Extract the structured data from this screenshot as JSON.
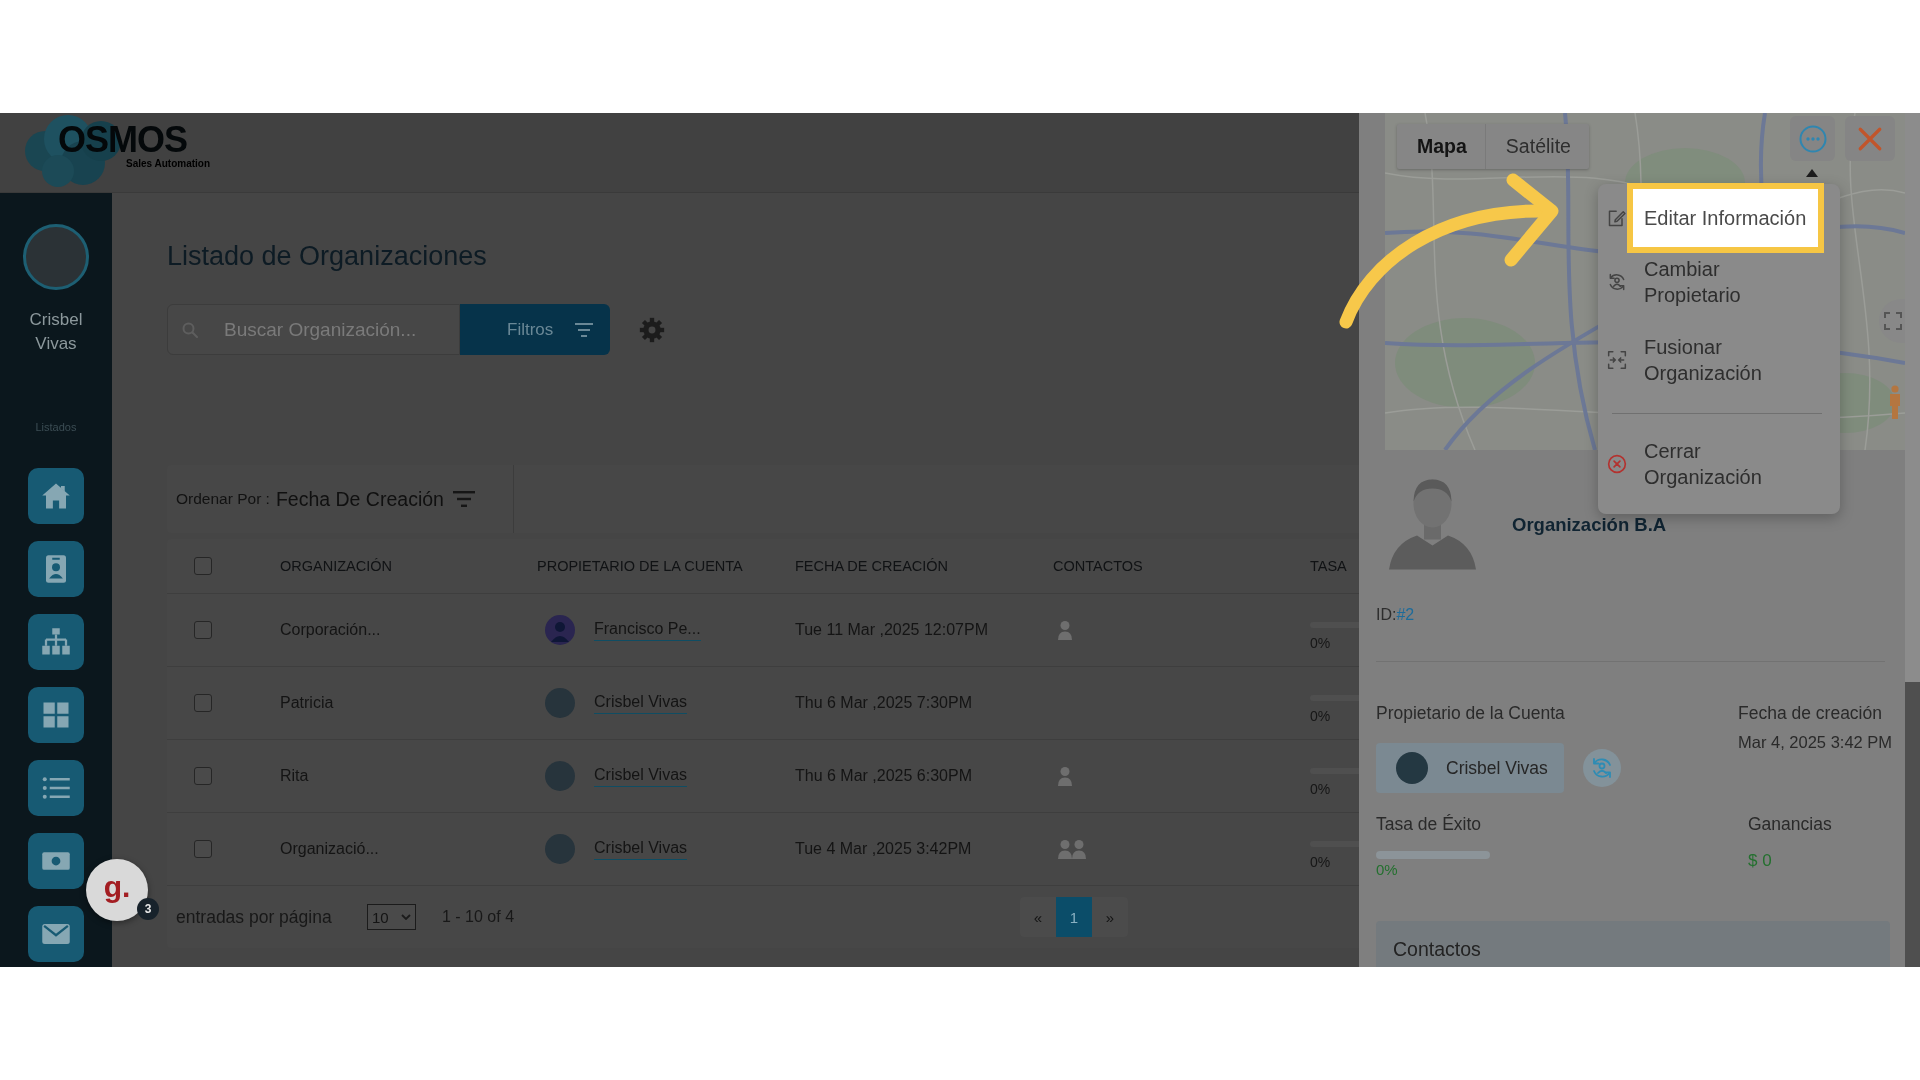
{
  "logo": {
    "name": "OSMOS",
    "tagline": "Sales Automation"
  },
  "sidebar": {
    "user": {
      "name": "Crisbel Vivas"
    },
    "section": "Listados"
  },
  "chat_widget": {
    "label": "g.",
    "badge": "3"
  },
  "page": {
    "title": "Listado de Organizaciones",
    "search": {
      "placeholder": "Buscar Organización..."
    },
    "filter_button": "Filtros",
    "sort": {
      "label": "Ordenar Por :",
      "value": "Fecha De Creación"
    }
  },
  "table": {
    "select_all": {
      "checked": false
    },
    "columns": [
      "ORGANIZACIÓN",
      "PROPIETARIO DE LA CUENTA",
      "FECHA DE CREACIÓN",
      "CONTACTOS",
      "TASA"
    ],
    "rows": [
      {
        "checked": false,
        "organization": "Corporación...",
        "owner": {
          "name": "Francisco Pe...",
          "avatar": {
            "kind": "illustration"
          }
        },
        "created": "Tue 11 Mar ,2025 12:07PM",
        "contacts": {
          "kind": "single"
        },
        "success_rate": {
          "level": 0,
          "reading": "0%"
        }
      },
      {
        "checked": false,
        "organization": "Patricia",
        "owner": {
          "name": "Crisbel Vivas",
          "avatar": {
            "kind": "photo"
          }
        },
        "created": "Thu 6 Mar ,2025 7:30PM",
        "success_rate": {
          "level": 0,
          "reading": "0%"
        }
      },
      {
        "checked": false,
        "organization": "Rita",
        "owner": {
          "name": "Crisbel Vivas",
          "avatar": {
            "kind": "photo"
          }
        },
        "created": "Thu 6 Mar ,2025 6:30PM",
        "contacts": {
          "kind": "single"
        },
        "success_rate": {
          "level": 0,
          "reading": "0%"
        }
      },
      {
        "checked": false,
        "organization": "Organizació...",
        "owner": {
          "name": "Crisbel Vivas",
          "avatar": {
            "kind": "photo"
          }
        },
        "created": "Tue 4 Mar ,2025 3:42PM",
        "contacts": {
          "kind": "group"
        },
        "success_rate": {
          "level": 0,
          "reading": "0%"
        }
      }
    ]
  },
  "footer": {
    "page_size_label": "entradas por página",
    "page_size": "10",
    "range": "1 - 10 of 4",
    "pages": [
      {
        "label": "«",
        "selected": false
      },
      {
        "label": "1",
        "selected": true
      },
      {
        "label": "»",
        "selected": false
      }
    ]
  },
  "drawer": {
    "map_types": [
      {
        "label": "Mapa",
        "selected": true
      },
      {
        "label": "Satélite",
        "selected": false
      }
    ],
    "menu": [
      {
        "kind": "action",
        "label": "Editar Información",
        "highlighted": true
      },
      {
        "kind": "action",
        "label": "Cambiar Propietario",
        "highlighted": false
      },
      {
        "kind": "action",
        "label": "Fusionar Organización",
        "highlighted": false
      },
      {
        "kind": "danger",
        "label": "Cerrar Organización",
        "highlighted": false
      }
    ],
    "organization": {
      "name": "Organización B.A",
      "id_label": "ID:",
      "id": "#2"
    },
    "owner": {
      "label": "Propietario de la Cuenta",
      "name": "Crisbel Vivas"
    },
    "created": {
      "label": "Fecha de creación",
      "value": "Mar 4, 2025 3:42 PM"
    },
    "success_rate": {
      "label": "Tasa de Éxito",
      "level": 0,
      "reading": "0%"
    },
    "earnings": {
      "label": "Ganancias",
      "value": "$ 0"
    },
    "contacts": {
      "title": "Contactos"
    }
  }
}
